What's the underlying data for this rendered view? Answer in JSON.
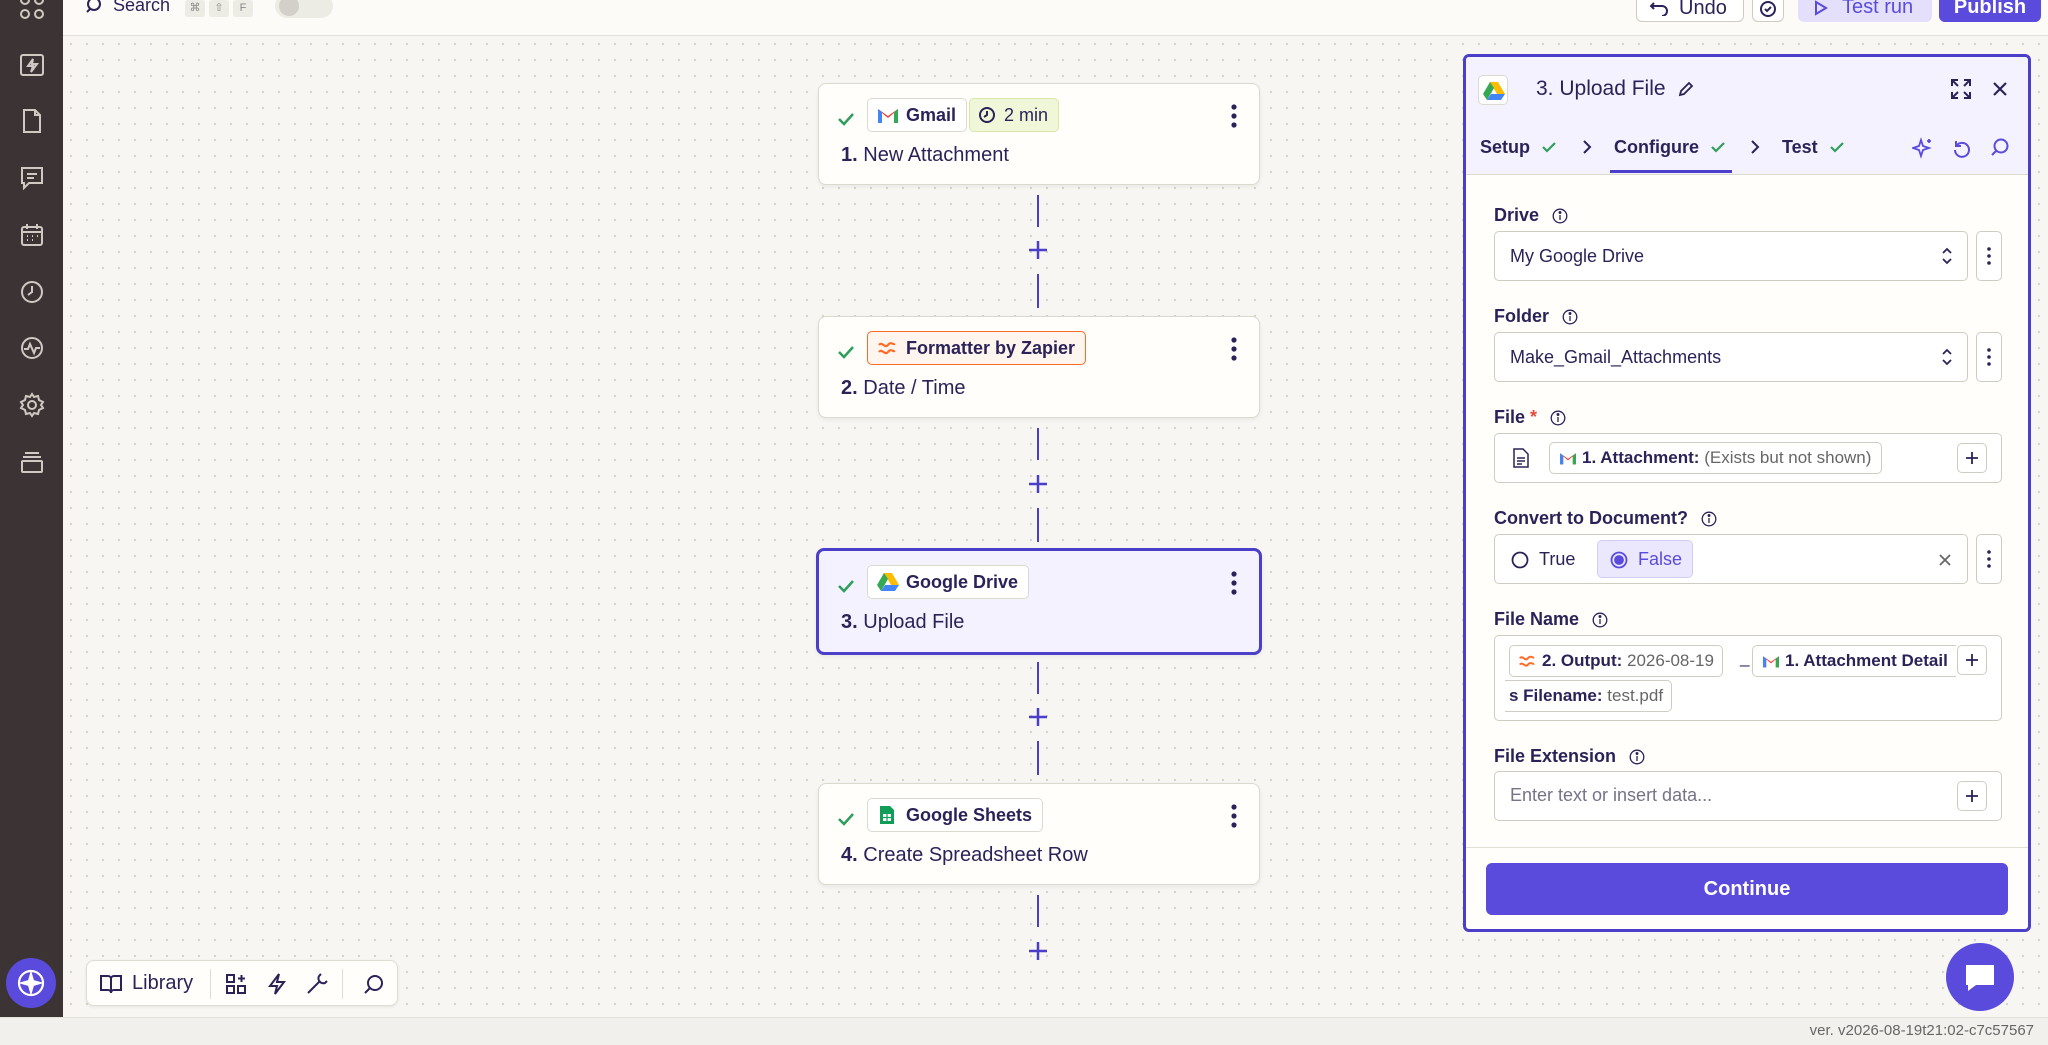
{
  "topbar": {
    "search_label": "Search",
    "shortcut_keys": [
      "⌘",
      "⇧",
      "F"
    ],
    "undo_label": "Undo",
    "test_run_label": "Test run",
    "publish_label": "Publish"
  },
  "steps": [
    {
      "app": "Gmail",
      "number": "1.",
      "title": "New Attachment",
      "badge": "2 min",
      "status": "check-icon"
    },
    {
      "app": "Formatter by Zapier",
      "number": "2.",
      "title": "Date / Time",
      "status": "check-icon"
    },
    {
      "app": "Google Drive",
      "number": "3.",
      "title": "Upload File",
      "status": "check-icon",
      "selected": true
    },
    {
      "app": "Google Sheets",
      "number": "4.",
      "title": "Create Spreadsheet Row",
      "status": "check-icon"
    }
  ],
  "library": {
    "label": "Library"
  },
  "panel": {
    "title": "3. Upload File",
    "tabs": [
      {
        "label": "Setup",
        "done": true
      },
      {
        "label": "Configure",
        "done": true,
        "active": true
      },
      {
        "label": "Test",
        "done": true
      }
    ],
    "fields": {
      "drive": {
        "label": "Drive",
        "value": "My Google Drive"
      },
      "folder": {
        "label": "Folder",
        "value": "Make_Gmail_Attachments"
      },
      "file": {
        "label": "File",
        "required_mark": "*",
        "pill_label": "1. Attachment:",
        "pill_value": "(Exists but not shown)"
      },
      "convert": {
        "label": "Convert to Document?",
        "options": [
          "True",
          "False"
        ],
        "selected": "False"
      },
      "file_name": {
        "label": "File Name",
        "pill1_label": "2. Output:",
        "pill1_value": "2026-08-19",
        "separator": "_",
        "pill2_label": "1. Attachment Detail",
        "pill3_label": "s Filename:",
        "pill3_value": "test.pdf"
      },
      "file_extension": {
        "label": "File Extension",
        "placeholder": "Enter text or insert data..."
      }
    },
    "continue_label": "Continue"
  },
  "version": "ver. v2026-08-19t21:02-c7c57567",
  "colors": {
    "accent": "#5a4bdc",
    "accent_border": "#4b3ec8",
    "success": "#2f9e5c",
    "formatter_orange": "#ff6a24",
    "rail": "#3c3434"
  }
}
